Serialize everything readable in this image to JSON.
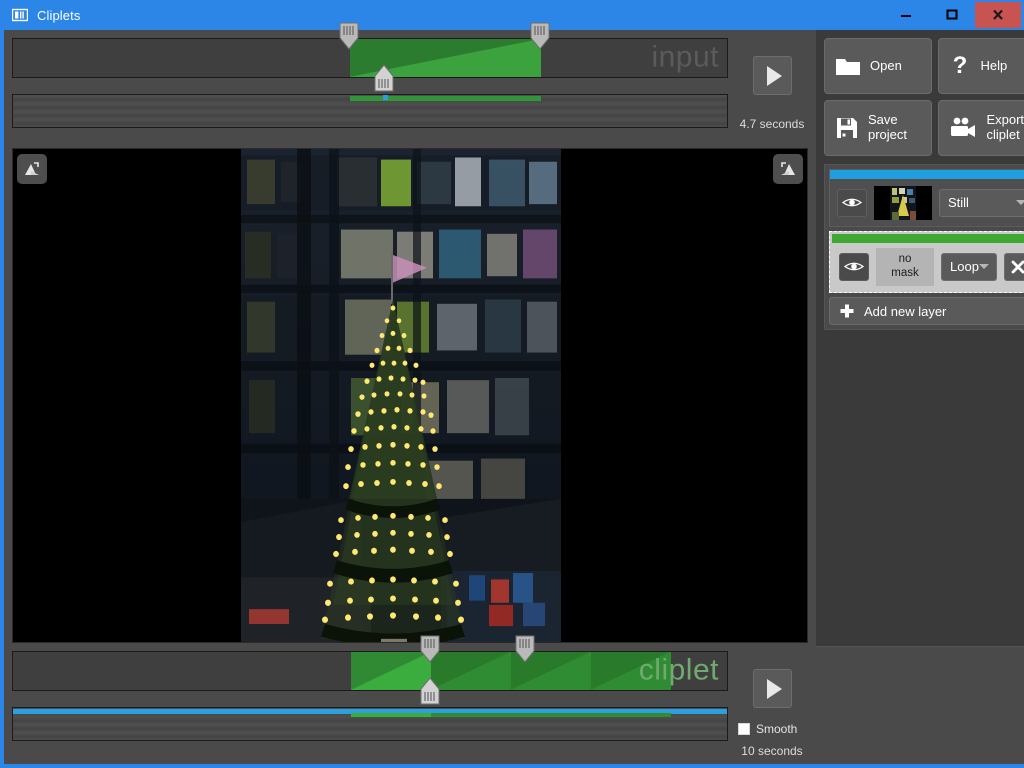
{
  "window": {
    "title": "Cliplets",
    "icon": "app-book-icon",
    "accent_color": "#2b86e8",
    "close_color": "#c75450",
    "controls": [
      {
        "name": "minimize",
        "glyph": "minimize-icon"
      },
      {
        "name": "maximize",
        "glyph": "maximize-icon"
      },
      {
        "name": "close",
        "glyph": "close-icon"
      }
    ]
  },
  "toolbar": {
    "buttons": [
      {
        "label": "Open",
        "icon": "folder-icon"
      },
      {
        "label": "Help",
        "icon": "question-mark-icon"
      },
      {
        "label": "Save\nproject",
        "label_line1": "Save",
        "label_line2": "project",
        "icon": "floppy-disk-icon"
      },
      {
        "label": "Export\ncliplet",
        "label_line1": "Export",
        "label_line2": "cliplet",
        "icon": "video-camera-icon"
      }
    ]
  },
  "layers": {
    "items": [
      {
        "accent_color": "#1f9fe0",
        "thumbnail": "video-frame-thumbnail",
        "mode": "Still",
        "selected": false,
        "visible": true,
        "has_close": false
      },
      {
        "accent_color": "#3fa832",
        "thumbnail_label_line1": "no",
        "thumbnail_label_line2": "mask",
        "mode": "Loop",
        "selected": true,
        "visible": true,
        "has_close": true,
        "close_icon": "close-x-icon"
      }
    ],
    "add_label": "Add new layer",
    "add_icon": "plus-icon"
  },
  "preview": {
    "corner_left_icon": "flip-horizontal-icon",
    "corner_right_icon": "flip-horizontal-mirrored-icon",
    "scene": "night city christmas tree with lights in front of illuminated building"
  },
  "input_timeline": {
    "watermark": "input",
    "duration_label": "4.7 seconds",
    "play_icon": "play-icon",
    "selection": {
      "start_pct": 47.2,
      "end_pct": 74.0
    },
    "playhead_pct": 52.1,
    "handles": [
      "start-handle",
      "end-handle",
      "playhead-handle"
    ],
    "region_color": "#2b7c2e",
    "region_highlight": "#3ba23e"
  },
  "cliplet_timeline": {
    "watermark": "cliplet",
    "duration_label": "10 seconds",
    "play_icon": "play-icon",
    "smooth_label": "Smooth",
    "smooth_checked": false,
    "loop_start_pct": 58.5,
    "loop_block_pct": 11.2,
    "playhead_pct": 58.5,
    "second_handle_pct": 71.8,
    "blocks": 4,
    "bar_color": "#2b9fe0",
    "region_color": "#2a7a2c",
    "region_highlight": "#3bad3f"
  }
}
